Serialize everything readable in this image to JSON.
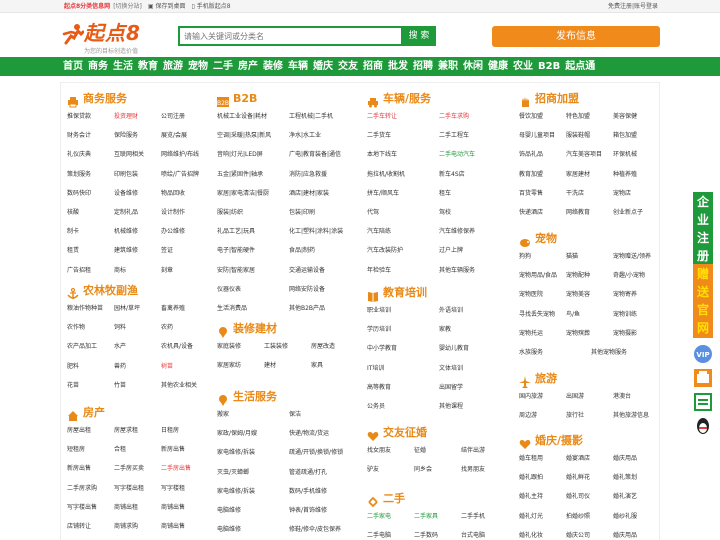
{
  "topbar": {
    "site_name": "起点8分类信息网",
    "switch_city": "[切换分站]",
    "save_desktop": "保存到桌面",
    "mobile": "手机版起点8",
    "register": "免费注册",
    "login": "账号登录"
  },
  "header": {
    "logo_text": "起点8",
    "slogan": "为您的目标创造价值",
    "search_placeholder": "请输入关键词或分类名",
    "search_button": "搜 索",
    "publish_button": "发布信息"
  },
  "nav": [
    "首页",
    "商务",
    "生活",
    "教育",
    "旅游",
    "宠物",
    "二手",
    "房产",
    "装修",
    "车辆",
    "婚庆",
    "交友",
    "招商",
    "批发",
    "招聘",
    "兼职",
    "休闲",
    "健康",
    "农业",
    "B2B",
    "起点通"
  ],
  "colors": {
    "green": "#1e9a3b",
    "orange": "#f08a1b",
    "red": "#e4393c",
    "title": "#e98a18"
  },
  "columns": [
    {
      "sections": [
        {
          "title": "商务服务",
          "icon": "printer-icon",
          "rows": [
            [
              "推保贷款",
              "投资理财",
              "公司注册"
            ],
            [
              "财务会计",
              "保险服务",
              "展览/会展"
            ],
            [
              "礼仪庆典",
              "互联网相关",
              "网络维护/布线"
            ],
            [
              "策划服务",
              "印刷包装",
              "喷绘/广告招牌"
            ],
            [
              "数码快印",
              "设备维修",
              "物品回收"
            ],
            [
              "核酸",
              "定制礼品",
              "设计制作"
            ],
            [
              "制卡",
              "机械维修",
              "办公维修"
            ],
            [
              "租赁",
              "建筑维修",
              "签证"
            ],
            [
              "广告招租",
              "商标",
              "刻章"
            ]
          ],
          "highlights": [
            [
              0,
              1,
              "red"
            ]
          ]
        },
        {
          "title": "农林牧副渔",
          "icon": "anchor-icon",
          "rows": [
            [
              "粮油作物种苗",
              "园林/草坪",
              "畜禽养殖"
            ],
            [
              "农作物",
              "饲料",
              "农药"
            ],
            [
              "农产品加工",
              "水产",
              "农机具/设备"
            ],
            [
              "肥料",
              "兽药",
              "树苗"
            ],
            [
              "花苗",
              "竹苗",
              "其他农业相关"
            ]
          ],
          "highlights": [
            [
              3,
              2,
              "red"
            ]
          ]
        },
        {
          "title": "房产",
          "icon": "house-icon",
          "rows": [
            [
              "房屋出租",
              "房屋求租",
              "日租房"
            ],
            [
              "短租房",
              "合租",
              "新房出售"
            ],
            [
              "新房出售",
              "二手房买卖",
              "二手房出售"
            ],
            [
              "二手房求购",
              "写字楼出租",
              "写字楼租"
            ],
            [
              "写字楼出售",
              "商铺出租",
              "商铺出售"
            ],
            [
              "店铺转让",
              "商铺求购",
              "商铺出售"
            ]
          ],
          "highlights": [
            [
              2,
              2,
              "red"
            ]
          ]
        }
      ]
    },
    {
      "sections": [
        {
          "title": "B2B",
          "icon": "b2b-icon",
          "rows": [
            [
              "机械工业设备|耗材",
              "工程机械|二手机"
            ],
            [
              "空调|采暖|热泵|新风",
              "净水|水工业"
            ],
            [
              "音响|灯光|LED屏",
              "广电|教育装备|通信"
            ],
            [
              "五金|紧固件|轴承",
              "消防|应急救援"
            ],
            [
              "家居|家电清洁|餐厨",
              "酒店|建材|家装"
            ],
            [
              "服装|纺织",
              "包装|印刷"
            ],
            [
              "礼品工艺|玩具",
              "化工|塑料|涂料|涂装"
            ],
            [
              "电子|智能硬件",
              "食品|制药"
            ],
            [
              "安防|智能家居",
              "交通运输设备"
            ],
            [
              "仪器仪表",
              "网络安防设备"
            ],
            [
              "生活消费品",
              "其他B2B产品"
            ]
          ],
          "highlights": []
        },
        {
          "title": "装修建材",
          "icon": "pin-icon",
          "rows": [
            [
              "家庭装修",
              "工装装修",
              "房屋改造"
            ],
            [
              "家居家纺",
              "建材",
              "家具"
            ]
          ],
          "highlights": []
        },
        {
          "title": "生活服务",
          "icon": "pin-icon",
          "rows": [
            [
              "搬家",
              "保洁"
            ],
            [
              "家政/保姆/月嫂",
              "快递/物流/货运"
            ],
            [
              "家电维修/拆装",
              "疏通/开锁/换锁/修锁"
            ],
            [
              "灭虫/灭蟑螂",
              "管道疏通/打孔"
            ],
            [
              "家电维修/拆装",
              "数码/手机维修"
            ],
            [
              "电脑维修",
              "钟表/首饰维修"
            ],
            [
              "电脑维修",
              "修鞋/修伞/皮包保养"
            ]
          ],
          "highlights": []
        }
      ]
    },
    {
      "sections": [
        {
          "title": "车辆/服务",
          "icon": "car-icon",
          "rows": [
            [
              "二手车转让",
              "二手车求购"
            ],
            [
              "二手货车",
              "二手工程车"
            ],
            [
              "本地下线车",
              "二手电动汽车"
            ],
            [
              "拖拉机/收割机",
              "新车4S店"
            ],
            [
              "拼车/顺风车",
              "租车"
            ],
            [
              "代驾",
              "驾校"
            ],
            [
              "汽车陪练",
              "汽车维修保养"
            ],
            [
              "汽车改装防护",
              "过户上牌"
            ],
            [
              "年检验车",
              "其他车辆服务"
            ]
          ],
          "highlights": [
            [
              0,
              0,
              "red"
            ],
            [
              0,
              1,
              "red"
            ],
            [
              2,
              1,
              "green"
            ]
          ]
        },
        {
          "title": "教育培训",
          "icon": "book-icon",
          "rows": [
            [
              "职业培训",
              "外语培训"
            ],
            [
              "学历培训",
              "家教"
            ],
            [
              "中小学教育",
              "婴幼儿教育"
            ],
            [
              "IT培训",
              "文体培训"
            ],
            [
              "高等教育",
              "出国留学"
            ],
            [
              "公务员",
              "其他课程"
            ]
          ],
          "highlights": []
        },
        {
          "title": "交友征婚",
          "icon": "heart-icon",
          "rows": [
            [
              "找女朋友",
              "征婚",
              "结伴出游"
            ],
            [
              "驴友",
              "同乡会",
              "找男朋友"
            ]
          ],
          "highlights": []
        },
        {
          "title": "二手",
          "icon": "recycle-icon",
          "rows": [
            [
              "二手家电",
              "二手家具",
              "二手手机"
            ],
            [
              "二手电脑",
              "二手数码",
              "台式电脑"
            ]
          ],
          "highlights": [
            [
              0,
              0,
              "green"
            ],
            [
              0,
              1,
              "green"
            ]
          ]
        }
      ]
    },
    {
      "sections": [
        {
          "title": "招商加盟",
          "icon": "hand-icon",
          "rows": [
            [
              "餐饮加盟",
              "特色加盟",
              "美容保健"
            ],
            [
              "母婴儿童项目",
              "服装鞋帽",
              "箱包加盟"
            ],
            [
              "饰品礼品",
              "汽车美容项目",
              "环保机械"
            ],
            [
              "教育加盟",
              "家居建材",
              "种植养殖"
            ],
            [
              "百货零售",
              "干洗店",
              "宠物店"
            ],
            [
              "快递酒店",
              "网络教育",
              "创业新点子"
            ]
          ],
          "highlights": []
        },
        {
          "title": "宠物",
          "icon": "pig-icon",
          "rows": [
            [
              "狗狗",
              "猫猫",
              "宠物赠送/领养"
            ],
            [
              "宠物用品/食品",
              "宠物配种",
              "奇趣/小宠物"
            ],
            [
              "宠物医院",
              "宠物美容",
              "宠物寄养"
            ],
            [
              "寻找丢失宠物",
              "鸟/鱼",
              "宠物训练"
            ],
            [
              "宠物托运",
              "宠物殡葬",
              "宠物摄影"
            ],
            [
              "水族服务",
              "其他宠物服务"
            ]
          ],
          "highlights": []
        },
        {
          "title": "旅游",
          "icon": "plane-icon",
          "rows": [
            [
              "国内旅游",
              "出国游",
              "港澳台"
            ],
            [
              "周边游",
              "旅行社",
              "其他旅游信息"
            ]
          ],
          "highlights": []
        },
        {
          "title": "婚庆/摄影",
          "icon": "camera-icon",
          "rows": [
            [
              "婚车租用",
              "婚宴酒店",
              "婚庆用品"
            ],
            [
              "婚礼跟拍",
              "婚礼鲜花",
              "婚礼策划"
            ],
            [
              "婚礼主持",
              "婚礼司仪",
              "婚礼演艺"
            ],
            [
              "婚礼灯光",
              "拍婚纱照",
              "婚纱礼服"
            ],
            [
              "婚礼化妆",
              "婚庆公司",
              "婚庆用品"
            ]
          ],
          "highlights": []
        }
      ]
    }
  ],
  "rightbar": {
    "chars_green": [
      "企",
      "业",
      "注",
      "册"
    ],
    "chars_orange": [
      "赠",
      "送",
      "官",
      "网"
    ],
    "icons": [
      "vip-icon",
      "phone-icon",
      "wechat-icon",
      "qq-icon"
    ]
  }
}
